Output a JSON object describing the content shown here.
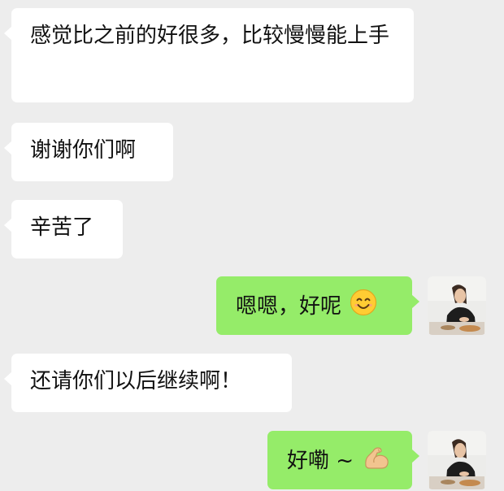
{
  "chat": {
    "messages": [
      {
        "side": "in",
        "text": "感觉比之前的好很多，比较慢慢能上手"
      },
      {
        "side": "in",
        "text": "谢谢你们啊"
      },
      {
        "side": "in",
        "text": "辛苦了"
      },
      {
        "side": "out",
        "text": "嗯嗯，好呢",
        "emoji": "smiling-face-icon"
      },
      {
        "side": "in",
        "text": "还请你们以后继续啊！"
      },
      {
        "side": "out",
        "text": "好嘞 ~",
        "emoji": "flexed-biceps-icon"
      }
    ]
  },
  "colors": {
    "background": "#ededed",
    "incoming_bubble": "#ffffff",
    "outgoing_bubble": "#95ec69"
  }
}
